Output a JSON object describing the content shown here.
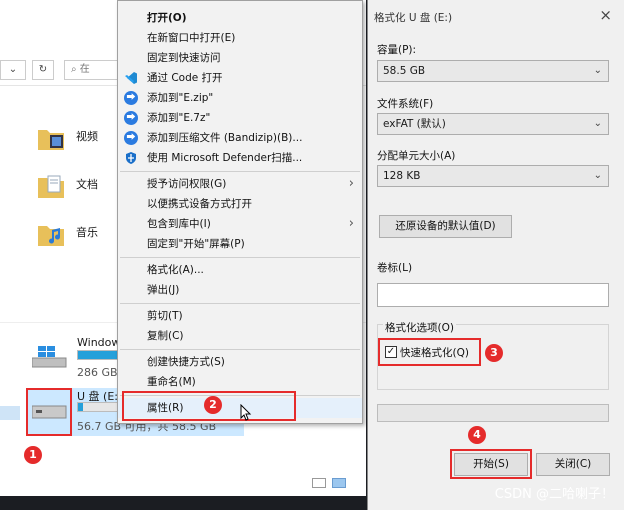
{
  "explorer": {
    "search_placeholder": "在",
    "folders": [
      {
        "label": "视频"
      },
      {
        "label": "文档"
      },
      {
        "label": "音乐"
      }
    ],
    "drives": [
      {
        "name": "Window",
        "size": "286 GB",
        "used_fraction": 0.55
      },
      {
        "name": "U 盘 (E:",
        "size": "56.7 GB 可用，共 58.5 GB",
        "used_fraction": 0.03
      }
    ]
  },
  "context_menu": {
    "items": [
      {
        "label": "打开(O)"
      },
      {
        "label": "在新窗口中打开(E)"
      },
      {
        "label": "固定到快速访问"
      },
      {
        "label": "通过 Code 打开",
        "icon": "vscode-icon"
      },
      {
        "label": "添加到\"E.zip\"",
        "icon": "bandizip-icon"
      },
      {
        "label": "添加到\"E.7z\"",
        "icon": "bandizip-icon"
      },
      {
        "label": "添加到压缩文件 (Bandizip)(B)...",
        "icon": "bandizip-icon"
      },
      {
        "label": "使用 Microsoft Defender扫描...",
        "icon": "defender-shield-icon"
      },
      {
        "label": "授予访问权限(G)"
      },
      {
        "label": "以便携式设备方式打开"
      },
      {
        "label": "包含到库中(I)"
      },
      {
        "label": "固定到\"开始\"屏幕(P)"
      },
      {
        "label": "格式化(A)..."
      },
      {
        "label": "弹出(J)"
      },
      {
        "label": "剪切(T)"
      },
      {
        "label": "复制(C)"
      },
      {
        "label": "创建快捷方式(S)"
      },
      {
        "label": "重命名(M)"
      },
      {
        "label": "属性(R)"
      }
    ]
  },
  "dialog": {
    "title": "格式化 U 盘 (E:)",
    "close": "×",
    "capacity_label": "容量(P):",
    "capacity_value": "58.5 GB",
    "fs_label": "文件系统(F)",
    "fs_value": "exFAT (默认)",
    "alloc_label": "分配单元大小(A)",
    "alloc_value": "128 KB",
    "restore_button": "还原设备的默认值(D)",
    "volume_label": "卷标(L)",
    "volume_value": "",
    "options_label": "格式化选项(O)",
    "quick_format": "快速格式化(Q)",
    "start_button": "开始(S)",
    "close_button": "关闭(C)"
  },
  "annotations": [
    "1",
    "2",
    "3",
    "4"
  ],
  "watermark": "CSDN @二哈喇子！"
}
